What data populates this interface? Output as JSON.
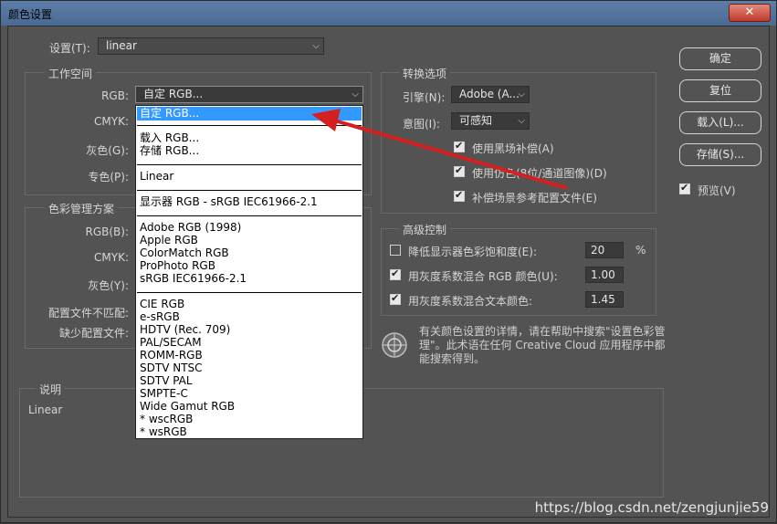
{
  "window": {
    "title": "颜色设置",
    "close": "✕"
  },
  "settings": {
    "label": "设置(T):",
    "value": "linear"
  },
  "workspace": {
    "title": "工作空间",
    "rgb_label": "RGB:",
    "rgb_value": "自定 RGB...",
    "cmyk_label": "CMYK:",
    "gray_label": "灰色(G):",
    "spot_label": "专色(P):"
  },
  "policies": {
    "title": "色彩管理方案",
    "rgb_label": "RGB(B):",
    "cmyk_label": "CMYK:",
    "gray_label": "灰色(Y):",
    "mismatch_label": "配置文件不匹配:",
    "missing_label": "缺少配置文件:"
  },
  "dropdown": {
    "selected": "自定 RGB...",
    "load": "载入 RGB...",
    "save": "存储 RGB...",
    "linear": "Linear",
    "monitor": "显示器 RGB - sRGB IEC61966-2.1",
    "group1": [
      "Adobe RGB (1998)",
      "Apple RGB",
      "ColorMatch RGB",
      "ProPhoto RGB",
      "sRGB IEC61966-2.1"
    ],
    "group2": [
      "CIE RGB",
      "e-sRGB",
      "HDTV (Rec. 709)",
      "PAL/SECAM",
      "ROMM-RGB",
      "SDTV NTSC",
      "SDTV PAL",
      "SMPTE-C",
      "Wide Gamut RGB",
      "* wscRGB",
      "* wsRGB"
    ]
  },
  "conversion": {
    "title": "转换选项",
    "engine_label": "引擎(N):",
    "engine_value": "Adobe (A...",
    "intent_label": "意图(I):",
    "intent_value": "可感知",
    "bpc": "使用黑场补偿(A)",
    "dither": "使用仿色(8位/通道图像)(D)",
    "compensate": "补偿场景参考配置文件(E)"
  },
  "advanced": {
    "title": "高级控制",
    "desaturate": "降低显示器色彩饱和度(E):",
    "desaturate_value": "20",
    "percent": "%",
    "blend_rgb": "用灰度系数混合 RGB 颜色(U):",
    "blend_rgb_value": "1.00",
    "blend_text": "用灰度系数混合文本颜色:",
    "blend_text_value": "1.45"
  },
  "info": "有关颜色设置的详情，请在帮助中搜索\"设置色彩管理\"。此术语在任何 Creative Cloud 应用程序中都能搜索得到。",
  "description": {
    "title": "说明",
    "text": "Linear"
  },
  "buttons": {
    "ok": "确定",
    "reset": "复位",
    "load": "载入(L)...",
    "save": "存储(S)...",
    "preview": "预览(V)"
  },
  "watermark": "https://blog.csdn.net/zengjunjie59",
  "colors": {
    "highlight": "#3399ff",
    "arrow": "#d42020",
    "panel": "#535353"
  }
}
